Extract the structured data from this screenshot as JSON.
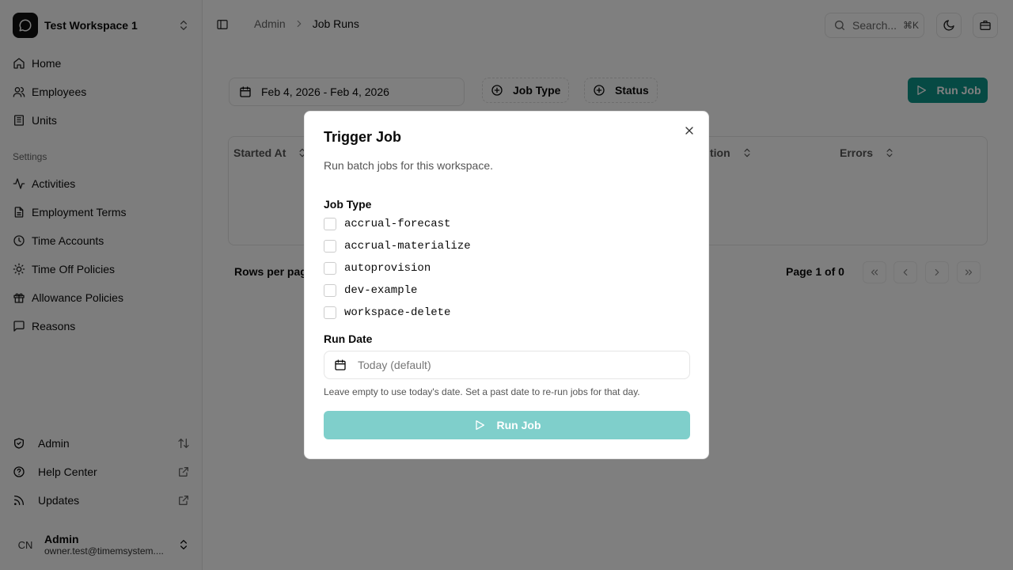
{
  "colors": {
    "accent": "#0d9488",
    "accent_disabled": "#7fcfcb",
    "overlay": "rgba(0,0,0,0.5)"
  },
  "sidebar": {
    "workspace": {
      "name": "Test Workspace 1",
      "logo_icon": "chat-bubble-icon",
      "switch_icon": "chevrons-up-down-icon"
    },
    "main_items": [
      {
        "label": "Home",
        "icon": "house-icon"
      },
      {
        "label": "Employees",
        "icon": "users-icon"
      },
      {
        "label": "Units",
        "icon": "building-icon"
      }
    ],
    "settings_group_label": "Settings",
    "settings_items": [
      {
        "label": "Activities",
        "icon": "activity-icon"
      },
      {
        "label": "Employment Terms",
        "icon": "document-icon"
      },
      {
        "label": "Time Accounts",
        "icon": "clock-icon"
      },
      {
        "label": "Time Off Policies",
        "icon": "sun-icon"
      },
      {
        "label": "Allowance Policies",
        "icon": "gift-icon"
      },
      {
        "label": "Reasons",
        "icon": "message-square-icon"
      }
    ],
    "bottom_items": [
      {
        "label": "Admin",
        "icon": "shield-check-icon",
        "right_icon": "arrow-up-down-icon"
      },
      {
        "label": "Help Center",
        "icon": "help-circle-icon",
        "right_icon": "external-link-icon"
      },
      {
        "label": "Updates",
        "icon": "rss-icon",
        "right_icon": "external-link-icon"
      }
    ],
    "user": {
      "initials": "CN",
      "name": "Admin",
      "email": "owner.test@timemsystem....",
      "menu_icon": "chevrons-up-down-icon"
    }
  },
  "header": {
    "breadcrumb": [
      "Admin",
      "Job Runs"
    ],
    "search_placeholder": "Search...",
    "search_shortcut": "⌘K",
    "theme_icon": "moon-icon",
    "extra_icon": "briefcase-icon"
  },
  "main": {
    "date_range": "Feb 4, 2026 - Feb 4, 2026",
    "filters": [
      "Job Type",
      "Status"
    ],
    "run_job_label": "Run Job",
    "columns": [
      "Started At",
      "tion",
      "Errors"
    ],
    "rows_per_page_label": "Rows per pag",
    "page_label": "Page 1 of 0"
  },
  "dialog": {
    "title": "Trigger Job",
    "description": "Run batch jobs for this workspace.",
    "job_type_label": "Job Type",
    "job_types": [
      "accrual-forecast",
      "accrual-materialize",
      "autoprovision",
      "dev-example",
      "workspace-delete"
    ],
    "run_date_label": "Run Date",
    "run_date_placeholder": "Today (default)",
    "hint": "Leave empty to use today's date. Set a past date to re-run jobs for that day.",
    "submit_label": "Run Job"
  }
}
